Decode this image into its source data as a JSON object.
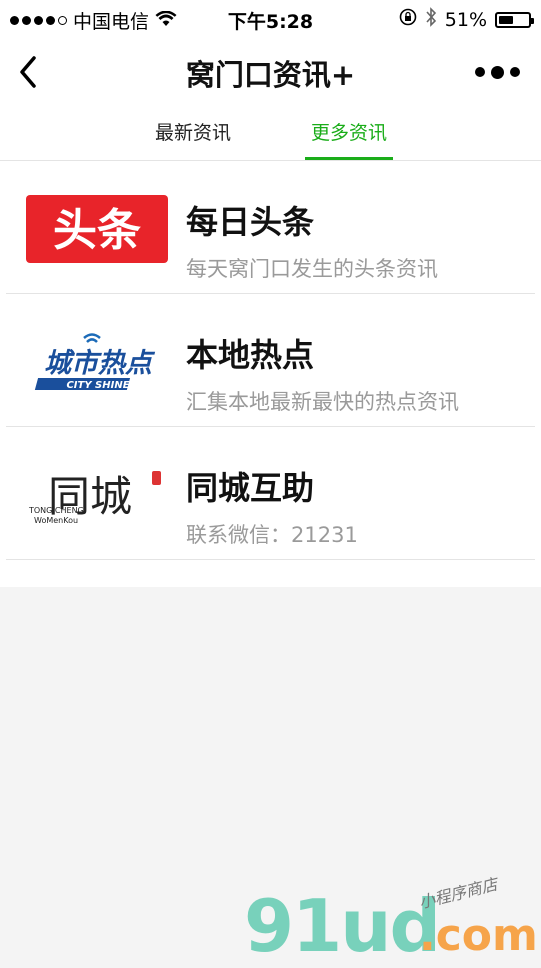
{
  "status_bar": {
    "carrier": "中国电信",
    "time": "下午5:28",
    "battery": "51%",
    "battery_level": 0.51,
    "signal_bars_filled": 4,
    "signal_bars_total": 5
  },
  "nav": {
    "title": "窝门口资讯+",
    "back_icon": "chevron-left-icon",
    "more_icon": "more-dots-icon"
  },
  "tabs": [
    {
      "label": "最新资讯",
      "active": false
    },
    {
      "label": "更多资讯",
      "active": true
    }
  ],
  "accent_color": "#1aad19",
  "items": [
    {
      "title": "每日头条",
      "desc": "每天窝门口发生的头条资讯",
      "logo_text": "头条"
    },
    {
      "title": "本地热点",
      "desc": "汇集本地最新最快的热点资讯",
      "logo_text": "城市热点",
      "logo_sub": "CITY SHINE"
    },
    {
      "title": "同城互助",
      "desc": "联系微信：21231",
      "logo_text": "同城",
      "logo_sub1": "TONG CHENG",
      "logo_sub2": "WoMenKou"
    }
  ],
  "watermark": {
    "main": "91ud",
    "com": ".com",
    "sub": "小程序商店"
  }
}
